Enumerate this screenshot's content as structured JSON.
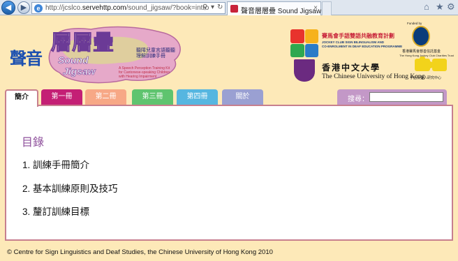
{
  "browser": {
    "url_prefix": "http://jcslco.",
    "url_domain": "servehttp.com",
    "url_path": "/sound_jigsaw/?book=intro",
    "tab_title": "聲音層層疊 Sound Jigsaw",
    "back_glyph": "◀",
    "forward_glyph": "▶",
    "search_glyph": "⚲",
    "refresh_glyph": "↻",
    "close_glyph": "×",
    "home_glyph": "⌂",
    "star_glyph": "★",
    "settings_glyph": "⚙"
  },
  "header": {
    "logo_chinese": "聲音",
    "logo_jigsaw": "層層疊",
    "logo_en_line1": "Sound",
    "logo_en_line2": "Jigsaw",
    "logo_side_line1": "聽障兒童言語聽聽",
    "logo_side_line2": "理解訓練手冊",
    "logo_desc_line1": "A Speech Perception Training Kit",
    "logo_desc_line2": "for Cantonese-speaking Children",
    "logo_desc_line3": "with Hearing Impairment",
    "sponsor_jc_zh": "賽馬會手語雙語共融教育計劃",
    "sponsor_jc_en_line1": "JOCKEY CLUB SIGN BILINGUALISM AND",
    "sponsor_jc_en_line2": "CO-ENROLMENT IN DEAF EDUCATION PROGRAMME",
    "sponsor_trust_top": "Funded by",
    "sponsor_trust_zh": "香港賽馬會慈善信託基金",
    "sponsor_trust_en": "The Hong Kong Jockey Club Charities Trust",
    "cuhk_zh": "香港中文大學",
    "cuhk_en": "The Chinese University of Hong Kong",
    "puzzle_zh": "手語及聾人研究中心"
  },
  "nav": {
    "tabs": [
      {
        "label": "簡介"
      },
      {
        "label": "第一冊"
      },
      {
        "label": "第二冊"
      },
      {
        "label": "第三冊"
      },
      {
        "label": "第四冊"
      },
      {
        "label": "關於"
      }
    ],
    "search_label": "搜尋：",
    "search_value": ""
  },
  "content": {
    "title": "目錄",
    "items": [
      {
        "num": "1.",
        "text": "訓練手冊簡介"
      },
      {
        "num": "2.",
        "text": "基本訓練原則及技巧"
      },
      {
        "num": "3.",
        "text": "釐訂訓練目標"
      }
    ]
  },
  "footer": {
    "text": "© Centre for Sign Linguistics and Deaf Studies, the Chinese University of Hong Kong 2010"
  },
  "colors": {
    "page_bg": "#fde9b8",
    "tab_book1": "#c41f75",
    "tab_book2": "#f7a886",
    "tab_book3": "#5fc46f",
    "tab_book4": "#56b6e0",
    "tab_about": "#9aa0d2",
    "search_bg": "#c398c7",
    "title_color": "#8e4f9b",
    "content_border": "#c77f8e"
  }
}
